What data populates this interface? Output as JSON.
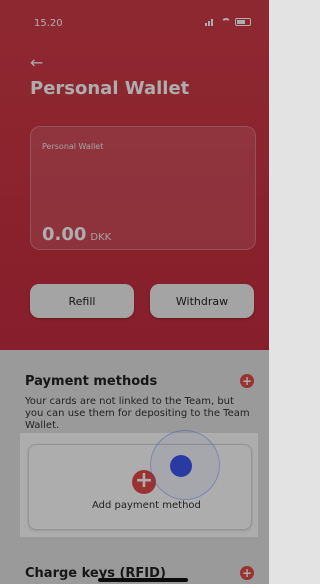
{
  "status_bar": {
    "time": "15.20"
  },
  "header": {
    "title": "Personal Wallet"
  },
  "wallet_card": {
    "label": "Personal Wallet",
    "amount": "0.00",
    "currency": "DKK"
  },
  "actions": {
    "refill": "Refill",
    "withdraw": "Withdraw"
  },
  "payment_methods": {
    "title": "Payment methods",
    "description": "Your cards are not linked to the Team, but you can use them for depositing to the Team Wallet.",
    "add_label": "Add payment method"
  },
  "charge_keys": {
    "title": "Charge keys (RFID)"
  },
  "colors": {
    "accent": "#c72d40",
    "add_button": "#e34a4a",
    "touch": "#3d56f0"
  }
}
